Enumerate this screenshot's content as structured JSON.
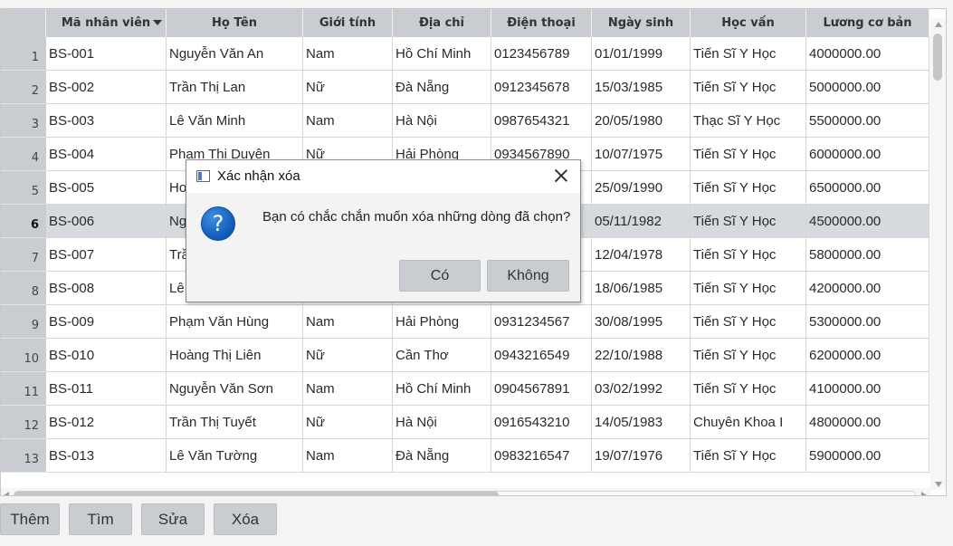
{
  "table": {
    "columns": [
      {
        "label": "Mã nhân viên",
        "width": 133,
        "sorted": true
      },
      {
        "label": "Họ Tên",
        "width": 151
      },
      {
        "label": "Giới tính",
        "width": 99
      },
      {
        "label": "Địa chỉ",
        "width": 109
      },
      {
        "label": "Điện thoại",
        "width": 111
      },
      {
        "label": "Ngày sinh",
        "width": 109
      },
      {
        "label": "Học vấn",
        "width": 128
      },
      {
        "label": "Lương cơ bản",
        "width": 136
      }
    ],
    "selected_row": 6,
    "rows": [
      {
        "num": "1",
        "cells": [
          "BS-001",
          "Nguyễn Văn An",
          "Nam",
          "Hồ Chí Minh",
          "0123456789",
          "01/01/1999",
          "Tiến Sĩ Y Học",
          "4000000.00"
        ]
      },
      {
        "num": "2",
        "cells": [
          "BS-002",
          "Trần Thị Lan",
          "Nữ",
          "Đà Nẵng",
          "0912345678",
          "15/03/1985",
          "Tiến Sĩ Y Học",
          "5000000.00"
        ]
      },
      {
        "num": "3",
        "cells": [
          "BS-003",
          "Lê Văn Minh",
          "Nam",
          "Hà Nội",
          "0987654321",
          "20/05/1980",
          "Thạc Sĩ Y Học",
          "5500000.00"
        ]
      },
      {
        "num": "4",
        "cells": [
          "BS-004",
          "Phạm Thị Duyên",
          "Nữ",
          "Hải Phòng",
          "0934567890",
          "10/07/1975",
          "Tiến Sĩ Y Học",
          "6000000.00"
        ]
      },
      {
        "num": "5",
        "cells": [
          "BS-005",
          "Ho",
          "",
          "",
          "",
          "25/09/1990",
          "Tiến Sĩ Y Học",
          "6500000.00"
        ]
      },
      {
        "num": "6",
        "cells": [
          "BS-006",
          "Ng",
          "",
          "",
          "",
          "05/11/1982",
          "Tiến Sĩ Y Học",
          "4500000.00"
        ]
      },
      {
        "num": "7",
        "cells": [
          "BS-007",
          "Trầ",
          "",
          "",
          "",
          "12/04/1978",
          "Tiến Sĩ Y Học",
          "5800000.00"
        ]
      },
      {
        "num": "8",
        "cells": [
          "BS-008",
          "Lê",
          "",
          "",
          "",
          "18/06/1985",
          "Tiến Sĩ Y Học",
          "4200000.00"
        ]
      },
      {
        "num": "9",
        "cells": [
          "BS-009",
          "Phạm Văn Hùng",
          "Nam",
          "Hải Phòng",
          "0931234567",
          "30/08/1995",
          "Tiến Sĩ Y Học",
          "5300000.00"
        ]
      },
      {
        "num": "10",
        "cells": [
          "BS-010",
          "Hoàng Thị Liên",
          "Nữ",
          "Cần Thơ",
          "0943216549",
          "22/10/1988",
          "Tiến Sĩ Y Học",
          "6200000.00"
        ]
      },
      {
        "num": "11",
        "cells": [
          "BS-011",
          "Nguyễn Văn Sơn",
          "Nam",
          "Hồ Chí Minh",
          "0904567891",
          "03/02/1992",
          "Tiến Sĩ Y Học",
          "4100000.00"
        ]
      },
      {
        "num": "12",
        "cells": [
          "BS-012",
          "Trần Thị Tuyết",
          "Nữ",
          "Hà Nội",
          "0916543210",
          "14/05/1983",
          "Chuyên Khoa I",
          "4800000.00"
        ]
      },
      {
        "num": "13",
        "cells": [
          "BS-013",
          "Lê Văn Tường",
          "Nam",
          "Đà Nẵng",
          "0983216547",
          "19/07/1976",
          "Tiến Sĩ Y Học",
          "5900000.00"
        ]
      }
    ]
  },
  "buttons": {
    "add": "Thêm",
    "find": "Tìm",
    "edit": "Sửa",
    "delete": "Xóa"
  },
  "dialog": {
    "title": "Xác nhận xóa",
    "message": "Bạn có chắc chắn muốn xóa những dòng đã chọn?",
    "yes": "Có",
    "no": "Không"
  },
  "colors": {
    "header_bg": "#c9ccd1",
    "selected_row_bg": "#d6d9dd",
    "question_icon": "#0f5ab8"
  },
  "icons": {
    "sort": "sort-desc-icon",
    "question": "question-icon",
    "close": "close-icon"
  }
}
